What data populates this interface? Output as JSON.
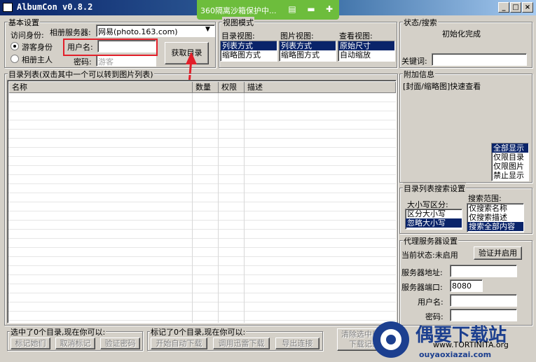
{
  "window": {
    "title": "AlbumCon v0.8.2"
  },
  "sandbox_bar": {
    "text": "360隔离沙箱保护中..."
  },
  "basic": {
    "legend": "基本设置",
    "visit_label": "访问身份:",
    "guest": "游客身份",
    "owner": "相册主人",
    "server_label": "相册服务器:",
    "server_value": "网易(photo.163.com)",
    "user_label": "用户名:",
    "user_value": "",
    "pass_label": "密码:",
    "pass_placeholder": "游客",
    "fetch_button": "获取目录"
  },
  "view": {
    "legend": "视图模式",
    "dir_label": "目录视图:",
    "dir_options": [
      "列表方式",
      "缩略图方式"
    ],
    "pic_label": "图片视图:",
    "pic_options": [
      "列表方式",
      "缩略图方式"
    ],
    "look_label": "查看视图:",
    "look_options": [
      "原始尺寸",
      "自动缩放"
    ]
  },
  "status": {
    "legend": "状态/搜索",
    "text": "初始化完成",
    "keyword_label": "关键词:",
    "keyword_value": ""
  },
  "dir_list": {
    "legend": "目录列表(双击其中一个可以转到图片列表)",
    "columns": [
      "名称",
      "数量",
      "权限",
      "描述"
    ]
  },
  "extra": {
    "legend": "附加信息",
    "cover_label": "[封面/缩略图]快速查看",
    "filter_options": [
      "全部显示",
      "仅限目录",
      "仅限图片",
      "禁止显示"
    ]
  },
  "search_settings": {
    "legend": "目录列表搜索设置",
    "case_label": "大小写区分:",
    "case_options": [
      "区分大小写",
      "忽略大小写"
    ],
    "scope_label": "搜索范围:",
    "scope_options": [
      "仅搜索名称",
      "仅搜索描述",
      "搜索全部内容"
    ]
  },
  "proxy": {
    "legend": "代理服务器设置",
    "state": "当前状态:未启用",
    "verify_button": "验证并启用",
    "addr_label": "服务器地址:",
    "addr_value": "",
    "port_label": "服务器端口:",
    "port_value": "8080",
    "user_label": "用户名:",
    "user_value": "",
    "pass_label": "密码:",
    "pass_value": ""
  },
  "selected": {
    "legend": "选中了0个目录,现在你可以:",
    "buttons": [
      "标记她们",
      "取消标记",
      "验证密码"
    ]
  },
  "marked": {
    "legend": "标记了0个目录,现在你可以:",
    "buttons": [
      "开始自动下载",
      "调用迅雷下载",
      "导出连接"
    ]
  },
  "clear_button": {
    "line1": "清除选中目录",
    "line2": "下载记录"
  },
  "watermark": {
    "title": "偶要下载站",
    "url1": "www.TORTINITA.org",
    "url2": "ouyaoxiazai.com"
  },
  "colors": {
    "selection": "#0a246a",
    "highlight_box": "#e21f2a",
    "sandbox": "#6dbd3c"
  }
}
